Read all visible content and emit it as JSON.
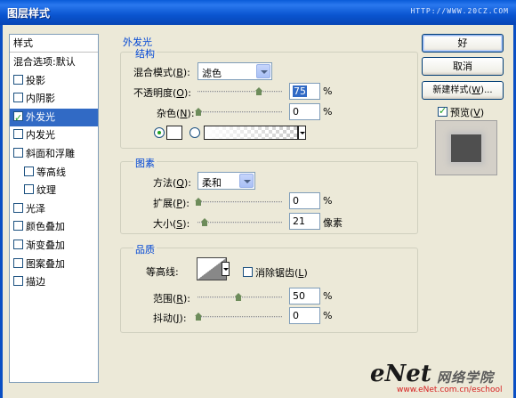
{
  "window": {
    "title": "图层样式",
    "watermark": "HTTP://WWW.20CZ.COM"
  },
  "left": {
    "header": "样式",
    "items": [
      {
        "label": "混合选项:默认",
        "checkbox": false,
        "checked": false,
        "selected": false,
        "indent": false
      },
      {
        "label": "投影",
        "checkbox": true,
        "checked": false,
        "selected": false,
        "indent": false
      },
      {
        "label": "内阴影",
        "checkbox": true,
        "checked": false,
        "selected": false,
        "indent": false
      },
      {
        "label": "外发光",
        "checkbox": true,
        "checked": true,
        "selected": true,
        "indent": false
      },
      {
        "label": "内发光",
        "checkbox": true,
        "checked": false,
        "selected": false,
        "indent": false
      },
      {
        "label": "斜面和浮雕",
        "checkbox": true,
        "checked": false,
        "selected": false,
        "indent": false
      },
      {
        "label": "等高线",
        "checkbox": true,
        "checked": false,
        "selected": false,
        "indent": true
      },
      {
        "label": "纹理",
        "checkbox": true,
        "checked": false,
        "selected": false,
        "indent": true
      },
      {
        "label": "光泽",
        "checkbox": true,
        "checked": false,
        "selected": false,
        "indent": false
      },
      {
        "label": "颜色叠加",
        "checkbox": true,
        "checked": false,
        "selected": false,
        "indent": false
      },
      {
        "label": "渐变叠加",
        "checkbox": true,
        "checked": false,
        "selected": false,
        "indent": false
      },
      {
        "label": "图案叠加",
        "checkbox": true,
        "checked": false,
        "selected": false,
        "indent": false
      },
      {
        "label": "描边",
        "checkbox": true,
        "checked": false,
        "selected": false,
        "indent": false
      }
    ]
  },
  "main": {
    "section_title": "外发光",
    "structure": {
      "title": "结构",
      "blend_mode_label": "混合模式(",
      "blend_mode_key": "B",
      "blend_mode_value": "滤色",
      "opacity_label": "不透明度(",
      "opacity_key": "O",
      "opacity_value": "75",
      "opacity_slider_fraction": 0.75,
      "noise_label": "杂色(",
      "noise_key": "N",
      "noise_value": "0",
      "noise_slider_fraction": 0,
      "percent": "%"
    },
    "elements": {
      "title": "图素",
      "technique_label": "方法(",
      "technique_key": "Q",
      "technique_value": "柔和",
      "spread_label": "扩展(",
      "spread_key": "P",
      "spread_value": "0",
      "spread_slider_fraction": 0,
      "size_label": "大小(",
      "size_key": "S",
      "size_value": "21",
      "size_slider_fraction": 0.08,
      "percent": "%",
      "px_unit": "像素"
    },
    "quality": {
      "title": "品质",
      "contour_label": "等高线:",
      "anti_alias_label": "消除锯齿(",
      "anti_alias_key": "L",
      "anti_alias_checked": false,
      "range_label": "范围(",
      "range_key": "R",
      "range_value": "50",
      "range_slider_fraction": 0.5,
      "jitter_label": "抖动(",
      "jitter_key": "J",
      "jitter_value": "0",
      "jitter_slider_fraction": 0,
      "percent": "%"
    }
  },
  "right": {
    "ok_label": "好",
    "cancel_label": "取消",
    "new_style_label": "新建样式(",
    "new_style_key": "W",
    "new_style_suffix": ")...",
    "preview_label": "预览(",
    "preview_key": "V",
    "preview_checked": true
  },
  "logo": {
    "brand": "eNet",
    "cn": "网络学院",
    "url": "www.eNet.com.cn/eschool"
  },
  "colors": {
    "accent": "#316ac5",
    "title_bar": "#0a5bd8",
    "group_title": "#0046d5"
  }
}
